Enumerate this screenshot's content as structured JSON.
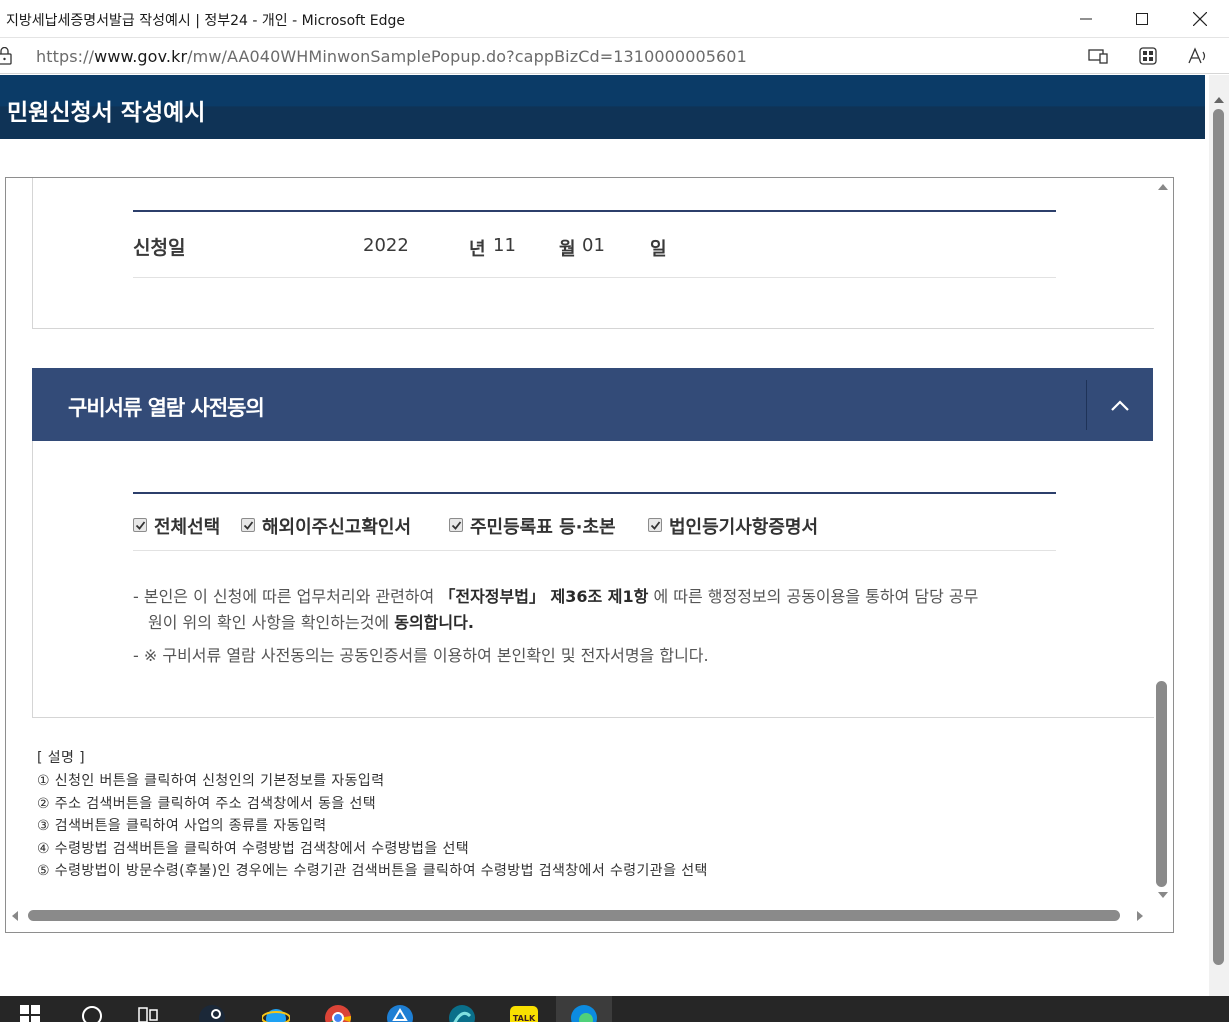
{
  "window": {
    "title": "지방세납세증명서발급 작성예시 | 정부24 - 개인 - Microsoft Edge",
    "controls": [
      "minimize-icon",
      "maximize-icon",
      "close-icon"
    ]
  },
  "address_bar": {
    "url_prefix": "https://",
    "url_domain": "www.gov.kr",
    "url_path": "/mw/AA040WHMinwonSamplePopup.do?cappBizCd=1310000005601",
    "icons": [
      "lock-icon",
      "app-available-icon",
      "browser-essentials-icon",
      "read-aloud-icon"
    ]
  },
  "page": {
    "title": "민원신청서 작성예시"
  },
  "application_date": {
    "label": "신청일",
    "year": "2022",
    "year_unit": "년",
    "month": "11",
    "month_unit": "월",
    "day": "01",
    "day_unit": "일"
  },
  "consent": {
    "heading": "구비서류 열람 사전동의",
    "collapse_icon": "chevron-up-icon",
    "checkboxes": [
      {
        "label": "전체선택",
        "checked": true
      },
      {
        "label": "해외이주신고확인서",
        "checked": true
      },
      {
        "label": "주민등록표 등·초본",
        "checked": true
      },
      {
        "label": "법인등기사항증명서",
        "checked": true
      }
    ],
    "note1_pre": "- 본인은 이 신청에 따른 업무처리와 관련하여 ",
    "note1_law": "「전자정부법」 제36조 제1항",
    "note1_post": " 에 따른 행정정보의 공동이용을 통하여 담당 공무",
    "note1_line2_pre": "원이 위의 확인 사항을 확인하는것에 ",
    "note1_line2_bold": "동의합니다.",
    "note2": "- ※ 구비서류 열람 사전동의는 공동인증서를 이용하여 본인확인 및 전자서명을 합니다."
  },
  "help": {
    "heading": "[ 설명 ]",
    "items": [
      "① 신청인 버튼을 클릭하여 신청인의 기본정보를 자동입력",
      "② 주소 검색버튼을 클릭하여 주소 검색창에서 동을 선택",
      "③ 검색버튼을 클릭하여 사업의 종류를 자동입력",
      "④ 수령방법 검색버튼을 클릭하여 수령방법 검색창에서 수령방법을 선택",
      "⑤ 수령방법이 방문수령(후불)인 경우에는 수령기관 검색버튼을 클릭하여 수령방법 검색창에서 수령기관을 선택"
    ]
  },
  "taskbar": {
    "icons": [
      "windows-start-icon",
      "search-icon",
      "task-view-icon",
      "steam-icon",
      "internet-explorer-icon",
      "chrome-icon",
      "app-icon",
      "app-icon-2",
      "kakaotalk-icon",
      "edge-icon"
    ],
    "kakaotalk_badge": "TALK",
    "colors": {
      "bar": "#262626",
      "header": "#0b3b67",
      "section": "#334b78"
    }
  }
}
